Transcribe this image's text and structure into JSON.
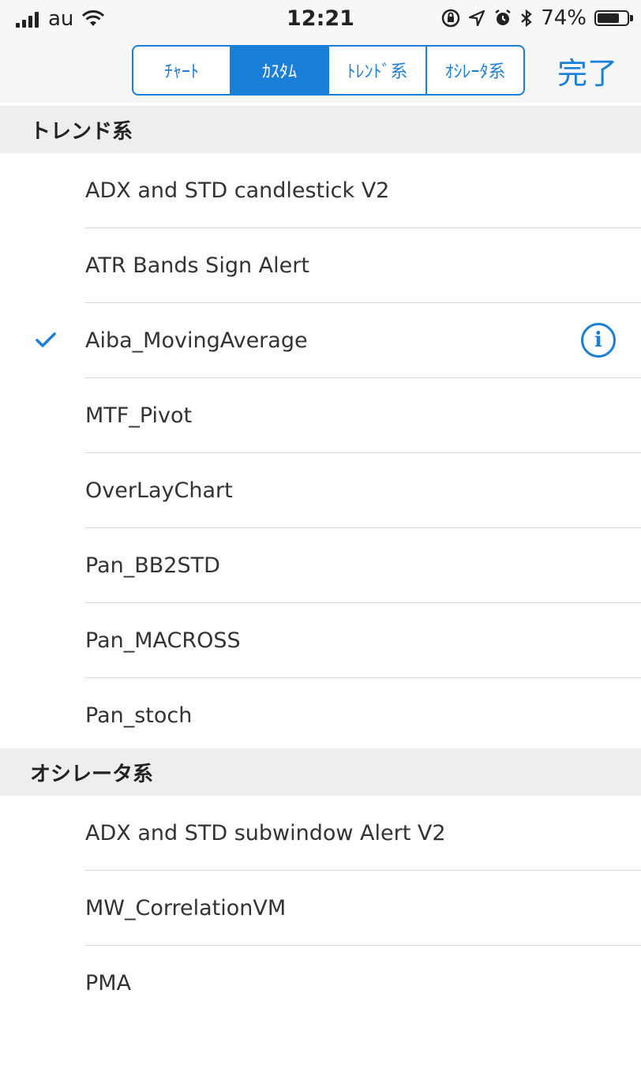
{
  "status_bar": {
    "carrier": "au",
    "time": "12:21",
    "battery_percent": "74%",
    "battery_level": 0.74,
    "icons": [
      "signal-icon",
      "wifi-icon",
      "lock-rotation-icon",
      "location-icon",
      "alarm-icon",
      "bluetooth-icon",
      "battery-icon"
    ]
  },
  "nav": {
    "segments": [
      "ﾁｬｰﾄ",
      "ｶｽﾀﾑ",
      "ﾄﾚﾝﾄﾞ系",
      "ｵｼﾚｰﾀ系"
    ],
    "active_segment": "ｶｽﾀﾑ",
    "done_label": "完了",
    "accent_color": "#1a7fd9"
  },
  "sections": [
    {
      "title": "トレンド系",
      "items": [
        {
          "label": "ADX and STD candlestick V2"
        },
        {
          "label": "ATR Bands Sign Alert"
        },
        {
          "label": "Aiba_MovingAverage",
          "checked": true,
          "info": true
        },
        {
          "label": "MTF_Pivot"
        },
        {
          "label": "OverLayChart"
        },
        {
          "label": "Pan_BB2STD"
        },
        {
          "label": "Pan_MACROSS"
        },
        {
          "label": "Pan_stoch"
        }
      ]
    },
    {
      "title": "オシレータ系",
      "items": [
        {
          "label": "ADX and STD subwindow Alert V2"
        },
        {
          "label": "MW_CorrelationVM"
        },
        {
          "label": "PMA"
        }
      ]
    }
  ]
}
